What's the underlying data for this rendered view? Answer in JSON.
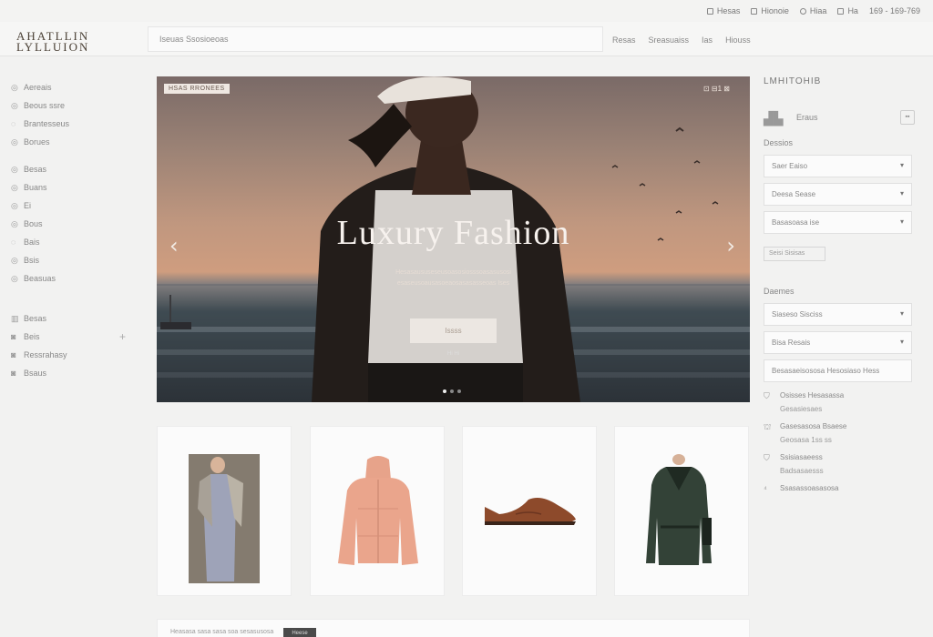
{
  "topbar": {
    "links": [
      "Hesas",
      "Hionoie",
      "Hiaa",
      "Ha",
      "169 - 169-769"
    ]
  },
  "header": {
    "logo_line1": "AHATLLIN",
    "logo_line2": "LYLLUION",
    "search_placeholder": "Iseuas Ssosioeoas",
    "nav": [
      "Resas",
      "Sreasuaiss",
      "Ias",
      "Hiouss"
    ]
  },
  "sidebar": {
    "group1": [
      {
        "icon": "◎",
        "label": "Aereais"
      },
      {
        "icon": "◎",
        "label": "Beous ssre"
      },
      {
        "icon": "◌",
        "label": "Brantesseus"
      },
      {
        "icon": "◎",
        "label": "Borues"
      }
    ],
    "group2": [
      {
        "icon": "◎",
        "label": "Besas"
      },
      {
        "icon": "◎",
        "label": "Buans"
      },
      {
        "icon": "◎",
        "label": "Ei"
      },
      {
        "icon": "◎",
        "label": "Bous"
      },
      {
        "icon": "◌",
        "label": "Bais"
      },
      {
        "icon": "◎",
        "label": "Bsis"
      },
      {
        "icon": "◎",
        "label": "Beasuas"
      }
    ],
    "group3": [
      {
        "icon": "▥",
        "label": "Besas"
      },
      {
        "icon": "◙",
        "label": "Beis",
        "plus": "+"
      },
      {
        "icon": "◙",
        "label": "Ressrahasy"
      },
      {
        "icon": "◙",
        "label": "Bsaus"
      }
    ]
  },
  "hero": {
    "tag": "HSAS RRONEES",
    "icons": "⊡  ⊟1  ⊠",
    "title": "Luxury Fashion",
    "subtitle": "Hesasaususeseusoasosiosssoasasusosi esaseusoausasoeaosasasasseoas Ises",
    "button": "Issss",
    "button_sub": "Hi Hi",
    "prev": "‹",
    "next": "›"
  },
  "right_panel": {
    "title": "LMHITOHIB",
    "account_label": "Eraus",
    "mini_label": "▪▪",
    "section1_title": "Dessios",
    "selects1": [
      "Saer Eaiso",
      "Deesa Sease",
      "Basasoasa ise"
    ],
    "chip": "Seisi Sisisas",
    "section2_title": "Daemes",
    "selects2": [
      "Siaseso Sisciss",
      "Bisa Resais",
      "Besasaeisososa Hesosiaso Hess"
    ],
    "info": [
      {
        "icon": "⛉",
        "line1": "Osisses Hesasassa",
        "line2": "Gesasiesaes"
      },
      {
        "icon": "⛫",
        "line1": "Gasesasosa Bsaese",
        "line2": "Geosasa  1ss   ss"
      },
      {
        "icon": "⛉",
        "line1": "Ssisiasaeess",
        "line2": "Badsasaesss"
      },
      {
        "icon": "⁴",
        "line1": "Ssasassoasasosa",
        "line2": ""
      }
    ]
  },
  "bottom_bar": {
    "text": "Heasasa sasa sasa soa sesasusosa",
    "button": "Heese"
  }
}
